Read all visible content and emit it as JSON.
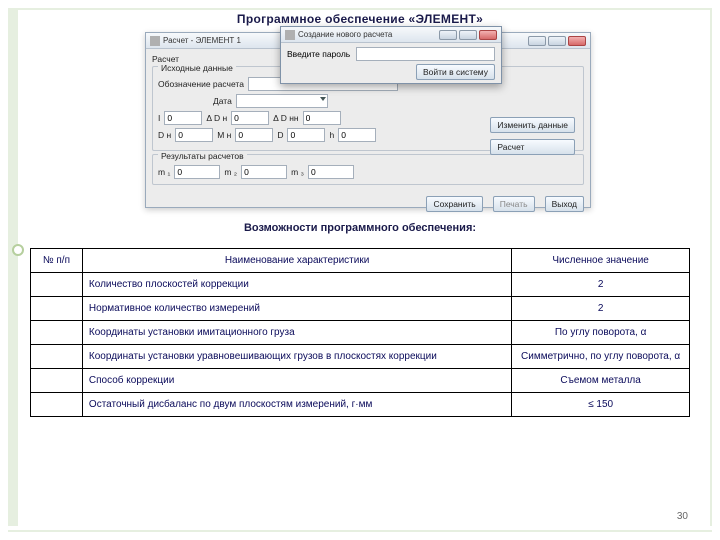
{
  "page": {
    "title": "Программное обеспечение «ЭЛЕМЕНТ»",
    "subtitle": "Возможности программного обеспечения:",
    "number": "30"
  },
  "main_window": {
    "title": "Расчет - ЭЛЕМЕНТ 1",
    "menu": {
      "file": "Расчет"
    },
    "group_input": {
      "legend": "Исходные данные",
      "label_desc": "Обозначение расчета",
      "desc_value": "",
      "label_date": "Дата",
      "date_value": "",
      "labels": {
        "I": "I",
        "dDn": "Δ D н",
        "dDnn": "Δ D нн",
        "Dn": "D н",
        "Mn": "M н",
        "D": "D",
        "h": "h"
      },
      "vals": {
        "I": "0",
        "dDn": "0",
        "dDnn": "0",
        "Dn": "0",
        "Mn": "0",
        "D": "0",
        "h": "0"
      },
      "btn_change": "Изменить данные",
      "btn_calc": "Расчет"
    },
    "group_results": {
      "legend": "Результаты расчетов",
      "labels": {
        "m1": "m ₁",
        "m2": "m ₂",
        "m3": "m ₃"
      },
      "vals": {
        "m1": "0",
        "m2": "0",
        "m3": "0"
      }
    },
    "footer": {
      "save": "Сохранить",
      "print": "Печать",
      "exit": "Выход"
    }
  },
  "login_dialog": {
    "title": "Создание нового расчета",
    "label": "Введите пароль",
    "value": "",
    "button": "Войти в систему"
  },
  "table": {
    "headers": {
      "num": "№ п/п",
      "name": "Наименование характеристики",
      "val": "Численное значение"
    },
    "rows": [
      {
        "num": "",
        "name": "Количество плоскостей коррекции",
        "val": "2"
      },
      {
        "num": "",
        "name": "Нормативное количество измерений",
        "val": "2"
      },
      {
        "num": "",
        "name": "Координаты установки имитационного груза",
        "val": "По углу поворота, α"
      },
      {
        "num": "",
        "name": "Координаты установки уравновешивающих грузов    в плоскостях коррекции",
        "val": "Симметрично, по углу поворота, α"
      },
      {
        "num": "",
        "name": "Способ коррекции",
        "val": "Съемом металла"
      },
      {
        "num": "",
        "name": "Остаточный дисбаланс по двум плоскостям измерений, г·мм",
        "val": "≤ 150"
      }
    ]
  }
}
